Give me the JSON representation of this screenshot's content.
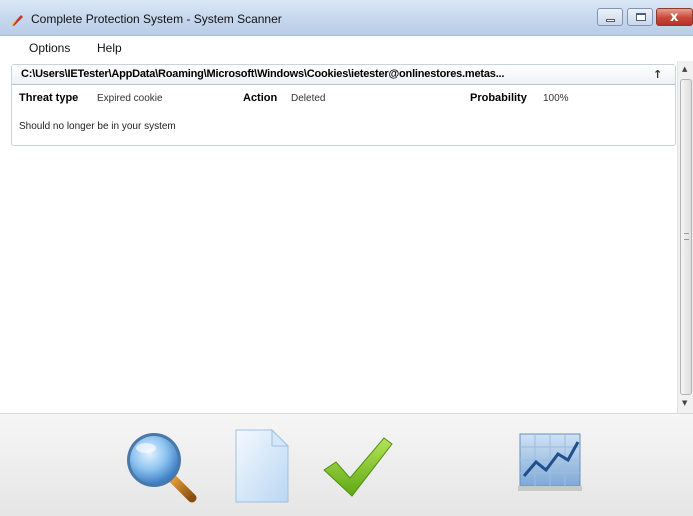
{
  "window": {
    "title": "Complete Protection System - System Scanner",
    "close_glyph": "x"
  },
  "menu": {
    "options": "Options",
    "help": "Help"
  },
  "result": {
    "path": "C:\\Users\\IETester\\AppData\\Roaming\\Microsoft\\Windows\\Cookies\\ietester@onlinestores.metas...",
    "collapse_glyph": "↑",
    "threat_label": "Threat type",
    "threat_value": "Expired cookie",
    "action_label": "Action",
    "action_value": "Deleted",
    "probability_label": "Probability",
    "probability_value": "100%",
    "detail": "Should no longer be in your system"
  },
  "scrollbar": {
    "up_glyph": "▲",
    "down_glyph": "▼"
  },
  "toolbar": {
    "icons": [
      "magnifier-icon",
      "document-icon",
      "checkmark-icon",
      "chart-icon"
    ]
  },
  "colors": {
    "titlebar": "#c7d8ee",
    "close_button": "#c8473a",
    "checkmark": "#7cc21e",
    "magnifier_lens": "#7fb6e8"
  }
}
